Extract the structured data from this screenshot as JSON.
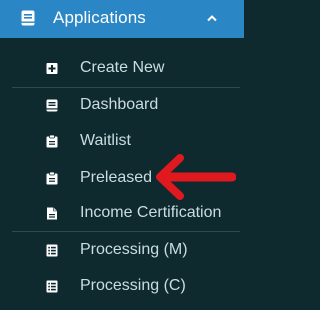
{
  "menu": {
    "header": {
      "title": "Applications",
      "icon": "book-icon",
      "chevron": "chevron-up-icon"
    },
    "items": [
      {
        "label": "Create New",
        "icon": "plus-square-icon"
      },
      {
        "label": "Dashboard",
        "icon": "dashboard-doc-icon"
      },
      {
        "label": "Waitlist",
        "icon": "clipboard-icon"
      },
      {
        "label": "Preleased",
        "icon": "clipboard-icon"
      },
      {
        "label": "Income Certification",
        "icon": "document-icon"
      },
      {
        "label": "Processing (M)",
        "icon": "list-doc-icon"
      },
      {
        "label": "Processing (C)",
        "icon": "list-doc-icon"
      }
    ]
  },
  "annotation": {
    "arrow_color": "#e0191f",
    "arrow_icon": "arrow-left-icon"
  },
  "colors": {
    "background": "#0f2a2f",
    "header": "#2a86c5",
    "text": "#c9dde0"
  }
}
